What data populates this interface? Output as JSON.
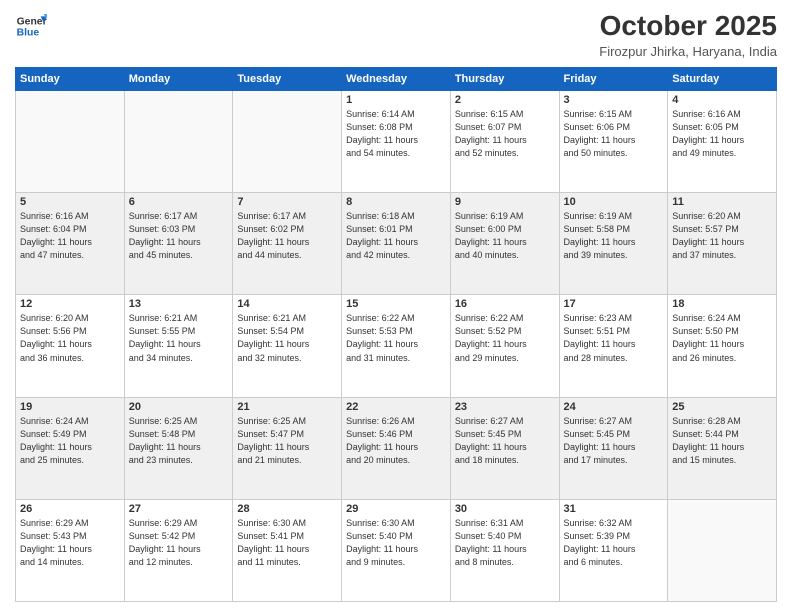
{
  "header": {
    "logo_line1": "General",
    "logo_line2": "Blue",
    "month_title": "October 2025",
    "location": "Firozpur Jhirka, Haryana, India"
  },
  "days_of_week": [
    "Sunday",
    "Monday",
    "Tuesday",
    "Wednesday",
    "Thursday",
    "Friday",
    "Saturday"
  ],
  "weeks": [
    [
      {
        "day": "",
        "info": ""
      },
      {
        "day": "",
        "info": ""
      },
      {
        "day": "",
        "info": ""
      },
      {
        "day": "1",
        "info": "Sunrise: 6:14 AM\nSunset: 6:08 PM\nDaylight: 11 hours\nand 54 minutes."
      },
      {
        "day": "2",
        "info": "Sunrise: 6:15 AM\nSunset: 6:07 PM\nDaylight: 11 hours\nand 52 minutes."
      },
      {
        "day": "3",
        "info": "Sunrise: 6:15 AM\nSunset: 6:06 PM\nDaylight: 11 hours\nand 50 minutes."
      },
      {
        "day": "4",
        "info": "Sunrise: 6:16 AM\nSunset: 6:05 PM\nDaylight: 11 hours\nand 49 minutes."
      }
    ],
    [
      {
        "day": "5",
        "info": "Sunrise: 6:16 AM\nSunset: 6:04 PM\nDaylight: 11 hours\nand 47 minutes."
      },
      {
        "day": "6",
        "info": "Sunrise: 6:17 AM\nSunset: 6:03 PM\nDaylight: 11 hours\nand 45 minutes."
      },
      {
        "day": "7",
        "info": "Sunrise: 6:17 AM\nSunset: 6:02 PM\nDaylight: 11 hours\nand 44 minutes."
      },
      {
        "day": "8",
        "info": "Sunrise: 6:18 AM\nSunset: 6:01 PM\nDaylight: 11 hours\nand 42 minutes."
      },
      {
        "day": "9",
        "info": "Sunrise: 6:19 AM\nSunset: 6:00 PM\nDaylight: 11 hours\nand 40 minutes."
      },
      {
        "day": "10",
        "info": "Sunrise: 6:19 AM\nSunset: 5:58 PM\nDaylight: 11 hours\nand 39 minutes."
      },
      {
        "day": "11",
        "info": "Sunrise: 6:20 AM\nSunset: 5:57 PM\nDaylight: 11 hours\nand 37 minutes."
      }
    ],
    [
      {
        "day": "12",
        "info": "Sunrise: 6:20 AM\nSunset: 5:56 PM\nDaylight: 11 hours\nand 36 minutes."
      },
      {
        "day": "13",
        "info": "Sunrise: 6:21 AM\nSunset: 5:55 PM\nDaylight: 11 hours\nand 34 minutes."
      },
      {
        "day": "14",
        "info": "Sunrise: 6:21 AM\nSunset: 5:54 PM\nDaylight: 11 hours\nand 32 minutes."
      },
      {
        "day": "15",
        "info": "Sunrise: 6:22 AM\nSunset: 5:53 PM\nDaylight: 11 hours\nand 31 minutes."
      },
      {
        "day": "16",
        "info": "Sunrise: 6:22 AM\nSunset: 5:52 PM\nDaylight: 11 hours\nand 29 minutes."
      },
      {
        "day": "17",
        "info": "Sunrise: 6:23 AM\nSunset: 5:51 PM\nDaylight: 11 hours\nand 28 minutes."
      },
      {
        "day": "18",
        "info": "Sunrise: 6:24 AM\nSunset: 5:50 PM\nDaylight: 11 hours\nand 26 minutes."
      }
    ],
    [
      {
        "day": "19",
        "info": "Sunrise: 6:24 AM\nSunset: 5:49 PM\nDaylight: 11 hours\nand 25 minutes."
      },
      {
        "day": "20",
        "info": "Sunrise: 6:25 AM\nSunset: 5:48 PM\nDaylight: 11 hours\nand 23 minutes."
      },
      {
        "day": "21",
        "info": "Sunrise: 6:25 AM\nSunset: 5:47 PM\nDaylight: 11 hours\nand 21 minutes."
      },
      {
        "day": "22",
        "info": "Sunrise: 6:26 AM\nSunset: 5:46 PM\nDaylight: 11 hours\nand 20 minutes."
      },
      {
        "day": "23",
        "info": "Sunrise: 6:27 AM\nSunset: 5:45 PM\nDaylight: 11 hours\nand 18 minutes."
      },
      {
        "day": "24",
        "info": "Sunrise: 6:27 AM\nSunset: 5:45 PM\nDaylight: 11 hours\nand 17 minutes."
      },
      {
        "day": "25",
        "info": "Sunrise: 6:28 AM\nSunset: 5:44 PM\nDaylight: 11 hours\nand 15 minutes."
      }
    ],
    [
      {
        "day": "26",
        "info": "Sunrise: 6:29 AM\nSunset: 5:43 PM\nDaylight: 11 hours\nand 14 minutes."
      },
      {
        "day": "27",
        "info": "Sunrise: 6:29 AM\nSunset: 5:42 PM\nDaylight: 11 hours\nand 12 minutes."
      },
      {
        "day": "28",
        "info": "Sunrise: 6:30 AM\nSunset: 5:41 PM\nDaylight: 11 hours\nand 11 minutes."
      },
      {
        "day": "29",
        "info": "Sunrise: 6:30 AM\nSunset: 5:40 PM\nDaylight: 11 hours\nand 9 minutes."
      },
      {
        "day": "30",
        "info": "Sunrise: 6:31 AM\nSunset: 5:40 PM\nDaylight: 11 hours\nand 8 minutes."
      },
      {
        "day": "31",
        "info": "Sunrise: 6:32 AM\nSunset: 5:39 PM\nDaylight: 11 hours\nand 6 minutes."
      },
      {
        "day": "",
        "info": ""
      }
    ]
  ]
}
